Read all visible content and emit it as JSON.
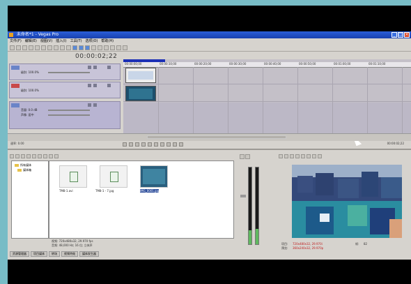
{
  "app": {
    "title": "未命名*1 - Vegas Pro"
  },
  "menu": {
    "items": [
      "文件(F)",
      "编辑(E)",
      "视图(V)",
      "插入(I)",
      "工具(T)",
      "选项(O)",
      "帮助(H)"
    ]
  },
  "timeline": {
    "timecode": "00:00:02;22"
  },
  "tracks": [
    {
      "number": "1",
      "line1": "级别: 100.0%",
      "line2": "",
      "kind": "video"
    },
    {
      "number": "2",
      "line1": "级别: 100.0%",
      "line2": "",
      "kind": "video"
    },
    {
      "number": "3",
      "line1": "音量: 0.0 dB",
      "line2": "声像: 居中",
      "kind": "audio"
    }
  ],
  "ruler": {
    "ticks": [
      "00:00:00;00",
      "00:00:10;00",
      "00:00:20;00",
      "00:00:30;00",
      "00:00:40;00",
      "00:00:50;00",
      "00:01:00;00",
      "00:01:10;00",
      "00:01:20;00"
    ]
  },
  "transport": {
    "rate_label": "速率: 0.00",
    "timecode_right": "00:00:02;22"
  },
  "media": {
    "tree": [
      "所有媒体",
      "媒体箱"
    ],
    "files": [
      {
        "name": "TM8-1.avi",
        "kind": "file"
      },
      {
        "name": "TM8-1 - 7.jpg",
        "kind": "file"
      },
      {
        "name": "IMG_0001.jpg",
        "kind": "image"
      }
    ],
    "status_line1": "视频: 720x480x32, 29.970 fps",
    "status_line2": "音频: 48,000 Hz; 16 位; 立体声",
    "tabs": [
      "资源管理器",
      "项目媒体",
      "转场",
      "视频特效",
      "媒体发生器"
    ]
  },
  "preview": {
    "info_project_label": "项目:",
    "info_project_value": "720x480x32, 29.970i",
    "info_preview_label": "预览:",
    "info_preview_value": "360x240x32, 29.970p",
    "info_frame_label": "帧:",
    "info_frame_value": "82"
  }
}
